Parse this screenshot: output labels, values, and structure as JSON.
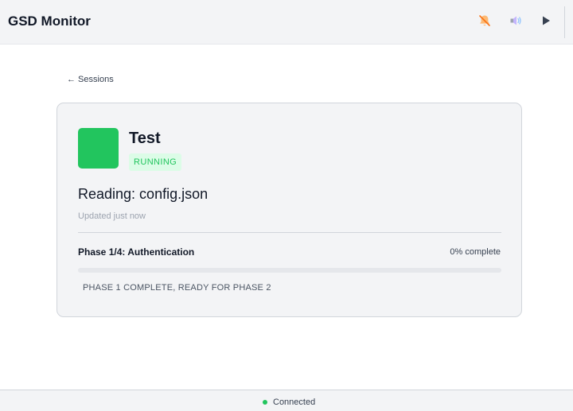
{
  "app": {
    "title": "GSD Monitor"
  },
  "toolbar": {
    "buttons": [
      {
        "icon": "notifications-muted-icon"
      },
      {
        "icon": "volume-icon"
      },
      {
        "icon": "play-icon"
      }
    ]
  },
  "nav": {
    "back_label": "← Sessions"
  },
  "session": {
    "name": "Test",
    "status": "RUNNING",
    "activity": "Reading: config.json",
    "updated": "Updated just now",
    "phase_label": "Phase 1/4: Authentication",
    "progress_label": "0% complete",
    "progress": 0,
    "message": "PHASE 1 COMPLETE, READY FOR PHASE 2"
  },
  "statusbar": {
    "connection": "Connected"
  },
  "colors": {
    "accent": "#22c55e",
    "status_badge_bg": "#dcfce7",
    "status_badge_text": "#22c55e",
    "muted_icon": "#f97316",
    "connected": "#22c55e"
  }
}
